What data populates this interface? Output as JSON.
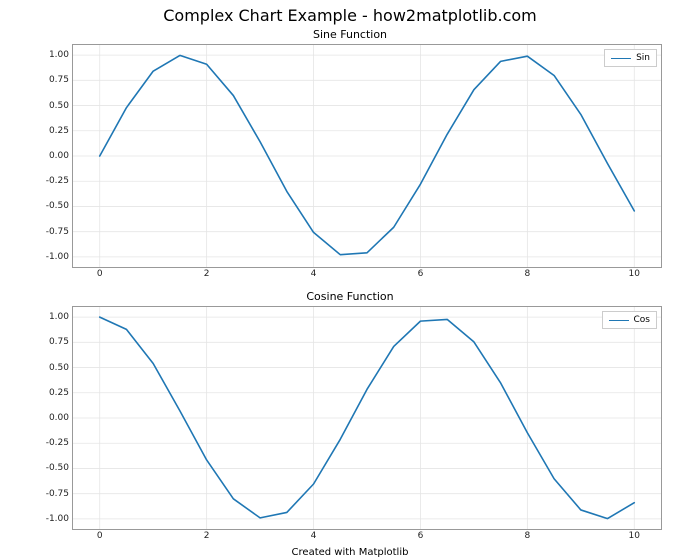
{
  "suptitle": "Complex Chart Example - how2matplotlib.com",
  "footer": "Created with Matplotlib",
  "subplots": [
    {
      "title": "Sine Function",
      "legend": "Sin"
    },
    {
      "title": "Cosine Function",
      "legend": "Cos"
    }
  ],
  "yticks": [
    "-1.00",
    "-0.75",
    "-0.50",
    "-0.25",
    "0.00",
    "0.25",
    "0.50",
    "0.75",
    "1.00"
  ],
  "xticks": [
    "0",
    "2",
    "4",
    "6",
    "8",
    "10"
  ],
  "colors": {
    "line": "#1f77b4"
  },
  "chart_data": [
    {
      "type": "line",
      "title": "Sine Function",
      "xlabel": "",
      "ylabel": "",
      "xlim": [
        0,
        10
      ],
      "ylim": [
        -1.0,
        1.0
      ],
      "x_ticks": [
        0,
        2,
        4,
        6,
        8,
        10
      ],
      "y_ticks": [
        -1.0,
        -0.75,
        -0.5,
        -0.25,
        0.0,
        0.25,
        0.5,
        0.75,
        1.0
      ],
      "series": [
        {
          "name": "Sin",
          "x": [
            0.0,
            0.5,
            1.0,
            1.5,
            2.0,
            2.5,
            3.0,
            3.5,
            4.0,
            4.5,
            5.0,
            5.5,
            6.0,
            6.5,
            7.0,
            7.5,
            8.0,
            8.5,
            9.0,
            9.5,
            10.0
          ],
          "values": [
            0.0,
            0.479,
            0.841,
            0.997,
            0.909,
            0.599,
            0.141,
            -0.351,
            -0.757,
            -0.978,
            -0.959,
            -0.706,
            -0.279,
            0.215,
            0.657,
            0.938,
            0.989,
            0.798,
            0.412,
            -0.075,
            -0.544
          ]
        }
      ]
    },
    {
      "type": "line",
      "title": "Cosine Function",
      "xlabel": "",
      "ylabel": "",
      "xlim": [
        0,
        10
      ],
      "ylim": [
        -1.0,
        1.0
      ],
      "x_ticks": [
        0,
        2,
        4,
        6,
        8,
        10
      ],
      "y_ticks": [
        -1.0,
        -0.75,
        -0.5,
        -0.25,
        0.0,
        0.25,
        0.5,
        0.75,
        1.0
      ],
      "series": [
        {
          "name": "Cos",
          "x": [
            0.0,
            0.5,
            1.0,
            1.5,
            2.0,
            2.5,
            3.0,
            3.5,
            4.0,
            4.5,
            5.0,
            5.5,
            6.0,
            6.5,
            7.0,
            7.5,
            8.0,
            8.5,
            9.0,
            9.5,
            10.0
          ],
          "values": [
            1.0,
            0.878,
            0.54,
            0.071,
            -0.416,
            -0.801,
            -0.99,
            -0.936,
            -0.654,
            -0.211,
            0.284,
            0.709,
            0.96,
            0.977,
            0.754,
            0.347,
            -0.146,
            -0.602,
            -0.911,
            -0.997,
            -0.839
          ]
        }
      ]
    }
  ]
}
